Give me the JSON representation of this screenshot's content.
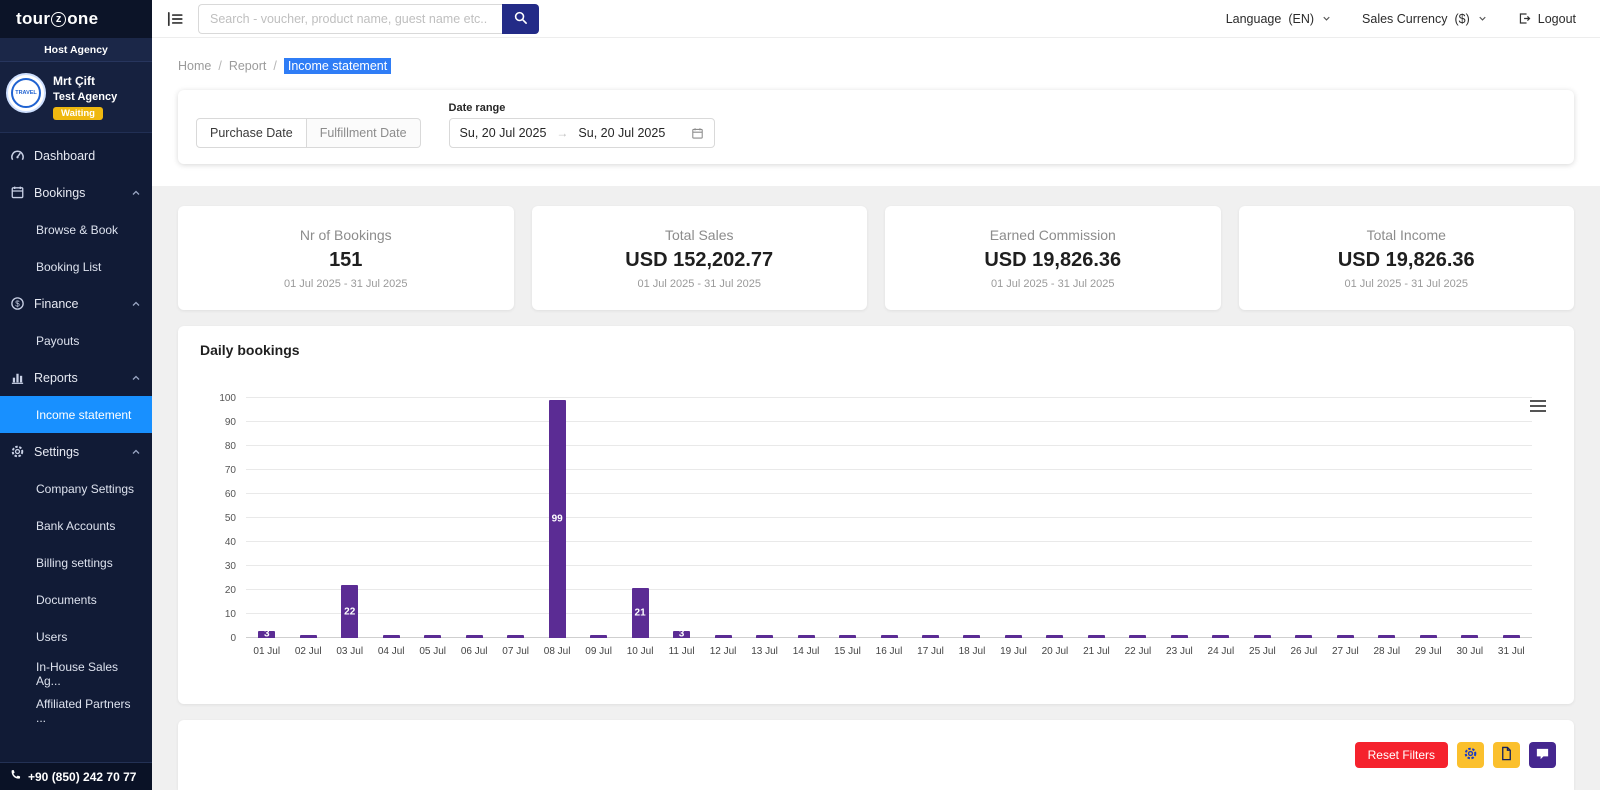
{
  "brand": {
    "logo": {
      "pre": "tour",
      "ring": "z",
      "post": "one"
    },
    "host_label": "Host Agency"
  },
  "profile": {
    "avatar_text": "TRAVEL",
    "name": "Mrt Çift",
    "agency": "Test Agency",
    "status": "Waiting"
  },
  "sidebar": {
    "items": [
      {
        "label": "Dashboard",
        "icon": "dashboard-icon",
        "type": "link"
      },
      {
        "label": "Bookings",
        "icon": "bookings-icon",
        "type": "group",
        "expanded": true
      },
      {
        "label": "Browse & Book",
        "type": "sub"
      },
      {
        "label": "Booking List",
        "type": "sub"
      },
      {
        "label": "Finance",
        "icon": "finance-icon",
        "type": "group",
        "expanded": true
      },
      {
        "label": "Payouts",
        "type": "sub"
      },
      {
        "label": "Reports",
        "icon": "reports-icon",
        "type": "group",
        "expanded": true
      },
      {
        "label": "Income statement",
        "type": "sub",
        "active": true
      },
      {
        "label": "Settings",
        "icon": "settings-icon",
        "type": "group",
        "expanded": true
      },
      {
        "label": "Company Settings",
        "type": "sub"
      },
      {
        "label": "Bank Accounts",
        "type": "sub"
      },
      {
        "label": "Billing settings",
        "type": "sub"
      },
      {
        "label": "Documents",
        "type": "sub"
      },
      {
        "label": "Users",
        "type": "sub"
      },
      {
        "label": "In-House Sales Ag...",
        "type": "sub"
      },
      {
        "label": "Affiliated Partners ...",
        "type": "sub"
      }
    ],
    "phone": "+90 (850) 242 70 77"
  },
  "topbar": {
    "search_placeholder": "Search - voucher, product name, guest name etc..",
    "language_label": "Language",
    "language_value": "(EN)",
    "currency_label": "Sales Currency",
    "currency_value": "($)",
    "logout_label": "Logout"
  },
  "breadcrumb": {
    "items": [
      "Home",
      "Report",
      "Income statement"
    ]
  },
  "filters": {
    "purchase_date_label": "Purchase Date",
    "fulfillment_date_label": "Fulfillment Date",
    "date_range_label": "Date range",
    "date_from": "Su, 20 Jul 2025",
    "date_to": "Su, 20 Jul 2025"
  },
  "stats": [
    {
      "title": "Nr of Bookings",
      "value": "151",
      "period": "01 Jul 2025 - 31 Jul 2025"
    },
    {
      "title": "Total Sales",
      "value": "USD 152,202.77",
      "period": "01 Jul 2025 - 31 Jul 2025"
    },
    {
      "title": "Earned Commission",
      "value": "USD 19,826.36",
      "period": "01 Jul 2025 - 31 Jul 2025"
    },
    {
      "title": "Total Income",
      "value": "USD 19,826.36",
      "period": "01 Jul 2025 - 31 Jul 2025"
    }
  ],
  "chart_data": {
    "type": "bar",
    "title": "Daily bookings",
    "categories": [
      "01 Jul",
      "02 Jul",
      "03 Jul",
      "04 Jul",
      "05 Jul",
      "06 Jul",
      "07 Jul",
      "08 Jul",
      "09 Jul",
      "10 Jul",
      "11 Jul",
      "12 Jul",
      "13 Jul",
      "14 Jul",
      "15 Jul",
      "16 Jul",
      "17 Jul",
      "18 Jul",
      "19 Jul",
      "20 Jul",
      "21 Jul",
      "22 Jul",
      "23 Jul",
      "24 Jul",
      "25 Jul",
      "26 Jul",
      "27 Jul",
      "28 Jul",
      "29 Jul",
      "30 Jul",
      "31 Jul"
    ],
    "values": [
      3,
      1,
      22,
      0,
      0,
      0,
      0,
      99,
      0,
      21,
      3,
      0,
      0,
      1,
      0,
      0,
      1,
      0,
      0,
      0,
      0,
      0,
      0,
      0,
      0,
      0,
      0,
      0,
      0,
      0,
      0
    ],
    "xlabel": "",
    "ylabel": "",
    "ylim": [
      0,
      100
    ],
    "ytick_step": 10,
    "grid": true,
    "legend": false,
    "bar_color": "#5b2c94",
    "label_min_value": 3
  },
  "actions": {
    "reset_filters_label": "Reset Filters"
  },
  "colors": {
    "sidebar_bg": "#111b36",
    "active_item": "#1890ff",
    "breadcrumb_highlight": "#2f7df6",
    "search_button": "#232b87",
    "bar": "#5b2c94",
    "reset_button": "#f5222d",
    "yellow_button": "#fbc02d",
    "purple_button": "#45278f",
    "waiting_badge": "#efb810"
  }
}
